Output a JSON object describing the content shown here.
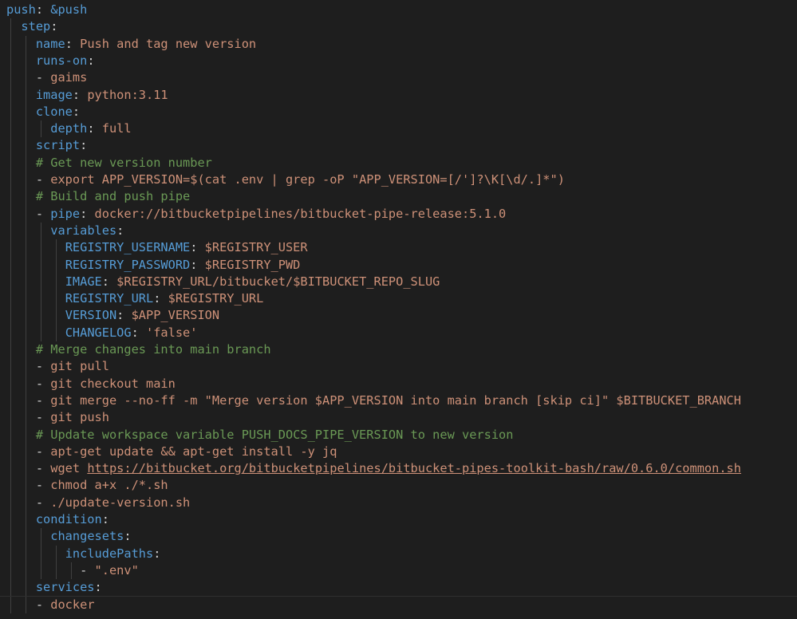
{
  "editor": {
    "language": "yaml",
    "colors": {
      "background": "#1e1e1e",
      "key": "#569cd6",
      "string": "#ce9178",
      "comment": "#6a9955",
      "punctuation": "#d4d4d4"
    },
    "lines": [
      [
        {
          "t": "push",
          "c": "k"
        },
        {
          "t": ": ",
          "c": "p"
        },
        {
          "t": "&push",
          "c": "a"
        }
      ],
      [
        {
          "t": "  "
        },
        {
          "t": "step",
          "c": "k"
        },
        {
          "t": ":",
          "c": "p"
        }
      ],
      [
        {
          "t": "    "
        },
        {
          "t": "name",
          "c": "k"
        },
        {
          "t": ": ",
          "c": "p"
        },
        {
          "t": "Push and tag new version",
          "c": "s"
        }
      ],
      [
        {
          "t": "    "
        },
        {
          "t": "runs-on",
          "c": "k"
        },
        {
          "t": ":",
          "c": "p"
        }
      ],
      [
        {
          "t": "    "
        },
        {
          "t": "- ",
          "c": "p"
        },
        {
          "t": "gaims",
          "c": "s"
        }
      ],
      [
        {
          "t": "    "
        },
        {
          "t": "image",
          "c": "k"
        },
        {
          "t": ": ",
          "c": "p"
        },
        {
          "t": "python:3.11",
          "c": "s"
        }
      ],
      [
        {
          "t": "    "
        },
        {
          "t": "clone",
          "c": "k"
        },
        {
          "t": ":",
          "c": "p"
        }
      ],
      [
        {
          "t": "      "
        },
        {
          "t": "depth",
          "c": "k"
        },
        {
          "t": ": ",
          "c": "p"
        },
        {
          "t": "full",
          "c": "s"
        }
      ],
      [
        {
          "t": "    "
        },
        {
          "t": "script",
          "c": "k"
        },
        {
          "t": ":",
          "c": "p"
        }
      ],
      [
        {
          "t": "    "
        },
        {
          "t": "# Get new version number",
          "c": "c"
        }
      ],
      [
        {
          "t": "    "
        },
        {
          "t": "- ",
          "c": "p"
        },
        {
          "t": "export APP_VERSION=$(cat .env | grep -oP \"APP_VERSION=[/']?\\K[\\d/.]*\")",
          "c": "s"
        }
      ],
      [
        {
          "t": "    "
        },
        {
          "t": "# Build and push pipe",
          "c": "c"
        }
      ],
      [
        {
          "t": "    "
        },
        {
          "t": "- ",
          "c": "p"
        },
        {
          "t": "pipe",
          "c": "k"
        },
        {
          "t": ": ",
          "c": "p"
        },
        {
          "t": "docker://bitbucketpipelines/bitbucket-pipe-release:5.1.0",
          "c": "s"
        }
      ],
      [
        {
          "t": "      "
        },
        {
          "t": "variables",
          "c": "k"
        },
        {
          "t": ":",
          "c": "p"
        }
      ],
      [
        {
          "t": "        "
        },
        {
          "t": "REGISTRY_USERNAME",
          "c": "k"
        },
        {
          "t": ": ",
          "c": "p"
        },
        {
          "t": "$REGISTRY_USER",
          "c": "s"
        }
      ],
      [
        {
          "t": "        "
        },
        {
          "t": "REGISTRY_PASSWORD",
          "c": "k"
        },
        {
          "t": ": ",
          "c": "p"
        },
        {
          "t": "$REGISTRY_PWD",
          "c": "s"
        }
      ],
      [
        {
          "t": "        "
        },
        {
          "t": "IMAGE",
          "c": "k"
        },
        {
          "t": ": ",
          "c": "p"
        },
        {
          "t": "$REGISTRY_URL/bitbucket/$BITBUCKET_REPO_SLUG",
          "c": "s"
        }
      ],
      [
        {
          "t": "        "
        },
        {
          "t": "REGISTRY_URL",
          "c": "k"
        },
        {
          "t": ": ",
          "c": "p"
        },
        {
          "t": "$REGISTRY_URL",
          "c": "s"
        }
      ],
      [
        {
          "t": "        "
        },
        {
          "t": "VERSION",
          "c": "k"
        },
        {
          "t": ": ",
          "c": "p"
        },
        {
          "t": "$APP_VERSION",
          "c": "s"
        }
      ],
      [
        {
          "t": "        "
        },
        {
          "t": "CHANGELOG",
          "c": "k"
        },
        {
          "t": ": ",
          "c": "p"
        },
        {
          "t": "'false'",
          "c": "s"
        }
      ],
      [
        {
          "t": "    "
        },
        {
          "t": "# Merge changes into main branch",
          "c": "c"
        }
      ],
      [
        {
          "t": "    "
        },
        {
          "t": "- ",
          "c": "p"
        },
        {
          "t": "git pull",
          "c": "s"
        }
      ],
      [
        {
          "t": "    "
        },
        {
          "t": "- ",
          "c": "p"
        },
        {
          "t": "git checkout main",
          "c": "s"
        }
      ],
      [
        {
          "t": "    "
        },
        {
          "t": "- ",
          "c": "p"
        },
        {
          "t": "git merge --no-ff -m \"Merge version $APP_VERSION into main branch [skip ci]\" $BITBUCKET_BRANCH",
          "c": "s"
        }
      ],
      [
        {
          "t": "    "
        },
        {
          "t": "- ",
          "c": "p"
        },
        {
          "t": "git push",
          "c": "s"
        }
      ],
      [
        {
          "t": "    "
        },
        {
          "t": "# Update workspace variable PUSH_DOCS_PIPE_VERSION to new version",
          "c": "c"
        }
      ],
      [
        {
          "t": "    "
        },
        {
          "t": "- ",
          "c": "p"
        },
        {
          "t": "apt-get update && apt-get install -y jq",
          "c": "s"
        }
      ],
      [
        {
          "t": "    "
        },
        {
          "t": "- ",
          "c": "p"
        },
        {
          "t": "wget ",
          "c": "s"
        },
        {
          "t": "https://bitbucket.org/bitbucketpipelines/bitbucket-pipes-toolkit-bash/raw/0.6.0/common.sh",
          "c": "s",
          "u": true
        }
      ],
      [
        {
          "t": "    "
        },
        {
          "t": "- ",
          "c": "p"
        },
        {
          "t": "chmod a+x ./*.sh",
          "c": "s"
        }
      ],
      [
        {
          "t": "    "
        },
        {
          "t": "- ",
          "c": "p"
        },
        {
          "t": "./update-version.sh",
          "c": "s"
        }
      ],
      [
        {
          "t": "    "
        },
        {
          "t": "condition",
          "c": "k"
        },
        {
          "t": ":",
          "c": "p"
        }
      ],
      [
        {
          "t": "      "
        },
        {
          "t": "changesets",
          "c": "k"
        },
        {
          "t": ":",
          "c": "p"
        }
      ],
      [
        {
          "t": "        "
        },
        {
          "t": "includePaths",
          "c": "k"
        },
        {
          "t": ":",
          "c": "p"
        }
      ],
      [
        {
          "t": "          "
        },
        {
          "t": "- ",
          "c": "p"
        },
        {
          "t": "\".env\"",
          "c": "s"
        }
      ],
      [
        {
          "t": "    "
        },
        {
          "t": "services",
          "c": "k"
        },
        {
          "t": ":",
          "c": "p"
        }
      ],
      [
        {
          "t": "    "
        },
        {
          "t": "- ",
          "c": "p"
        },
        {
          "t": "docker",
          "c": "s"
        }
      ]
    ]
  }
}
